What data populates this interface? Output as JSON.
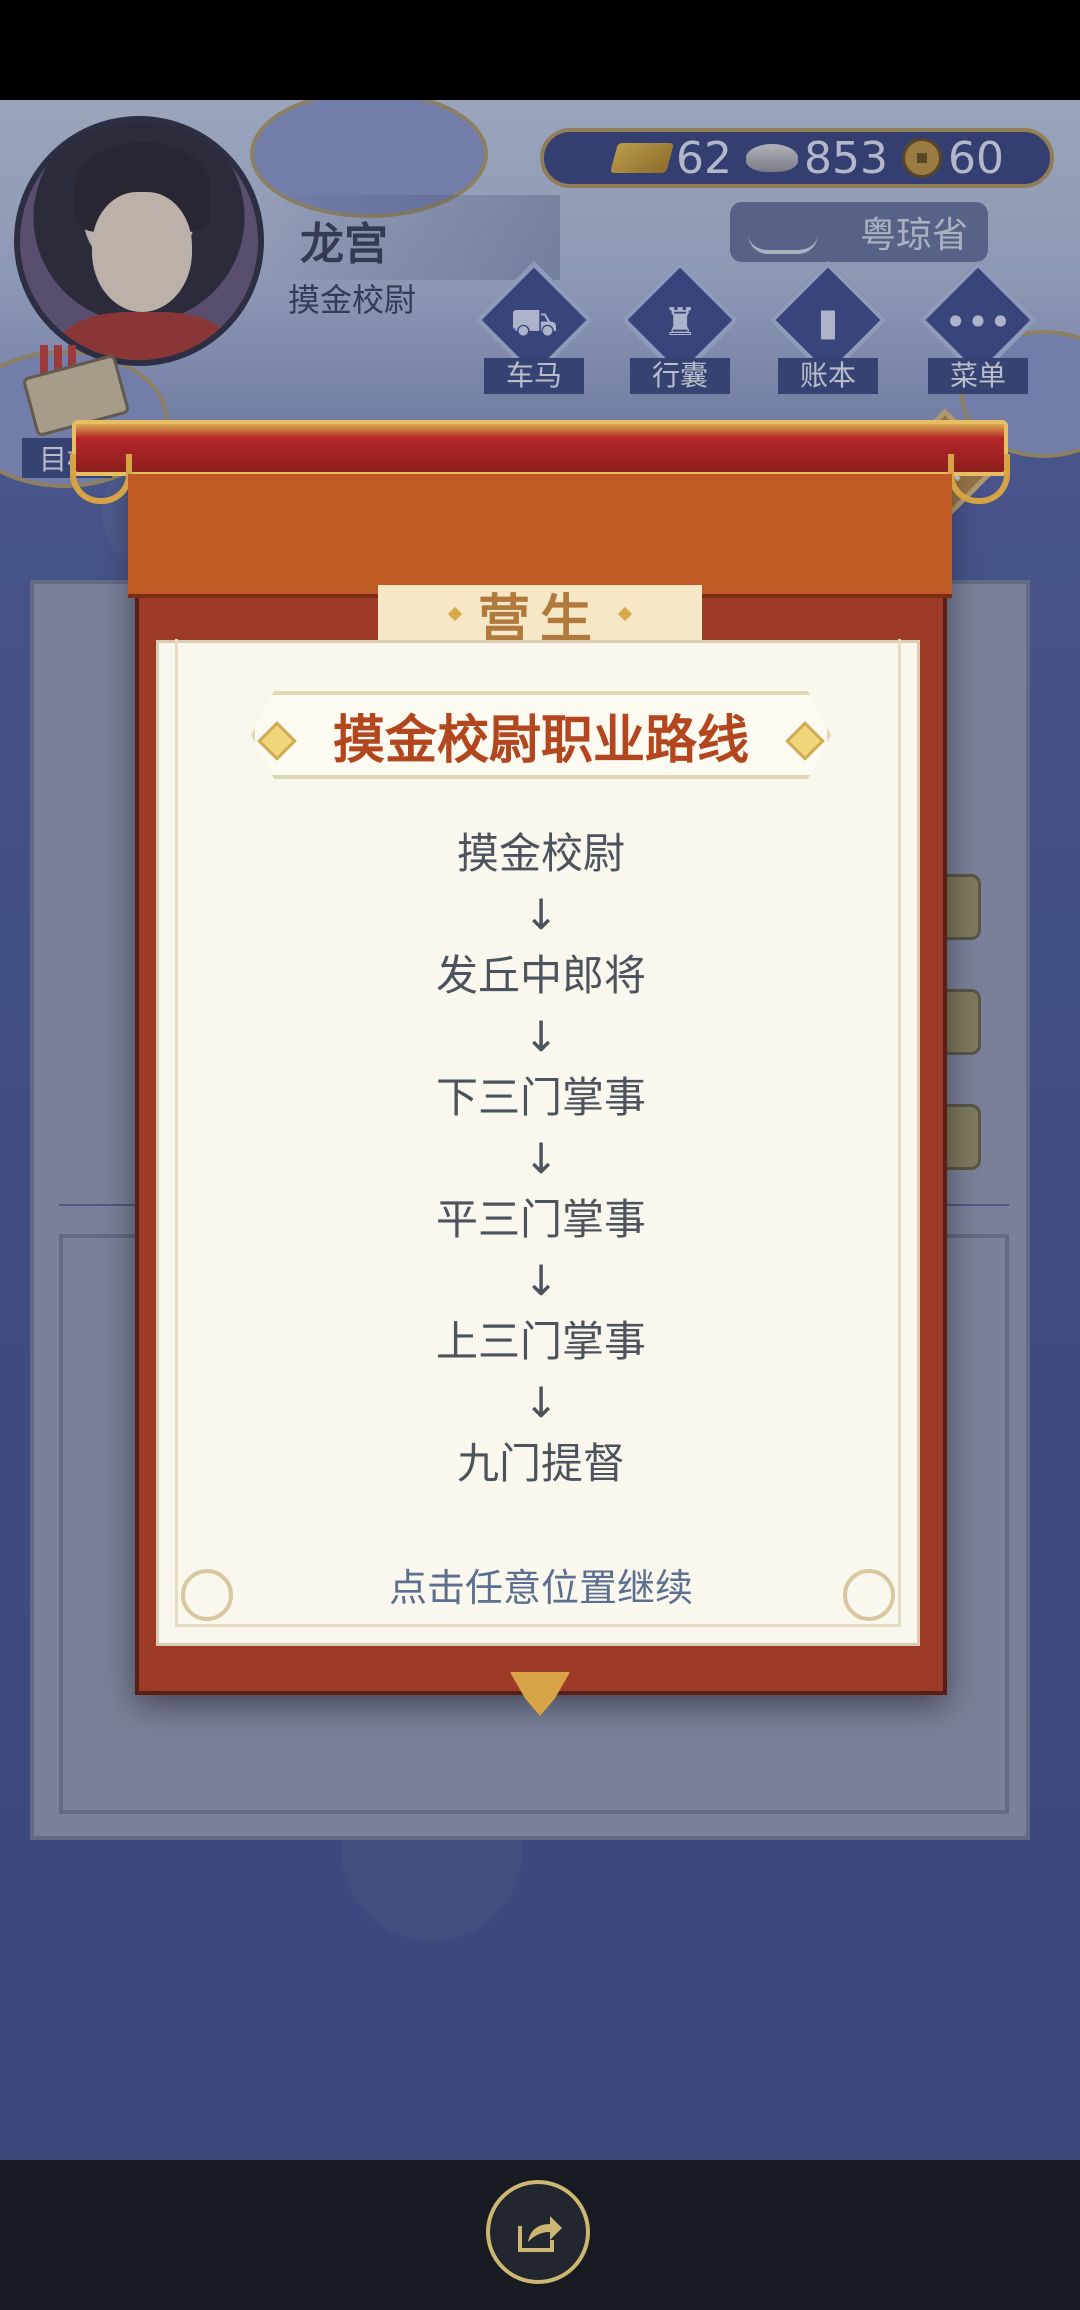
{
  "player": {
    "name": "龙宫",
    "title": "摸金校尉"
  },
  "currency": {
    "gold": "62",
    "silver": "853",
    "coins": "60"
  },
  "location": "粤琼省",
  "menu": {
    "items": [
      {
        "label": "车马",
        "icon": "carriage-icon"
      },
      {
        "label": "行囊",
        "icon": "bag-icon"
      },
      {
        "label": "账本",
        "icon": "ledger-icon"
      },
      {
        "label": "菜单",
        "icon": "more-icon"
      }
    ]
  },
  "goal_label": "目标",
  "background_title": "营生",
  "modal": {
    "tag": "营生",
    "heading": "摸金校尉职业路线",
    "career_path": [
      "摸金校尉",
      "发丘中郎将",
      "下三门掌事",
      "平三门掌事",
      "上三门掌事",
      "九门提督"
    ],
    "arrow": "↓",
    "continue_hint": "点击任意位置继续"
  },
  "colors": {
    "modal_frame": "#9d3a27",
    "banner": "#c05a24",
    "heading_text": "#b2461f",
    "paper": "#faf7ee",
    "game_background": "#4c5a98"
  }
}
